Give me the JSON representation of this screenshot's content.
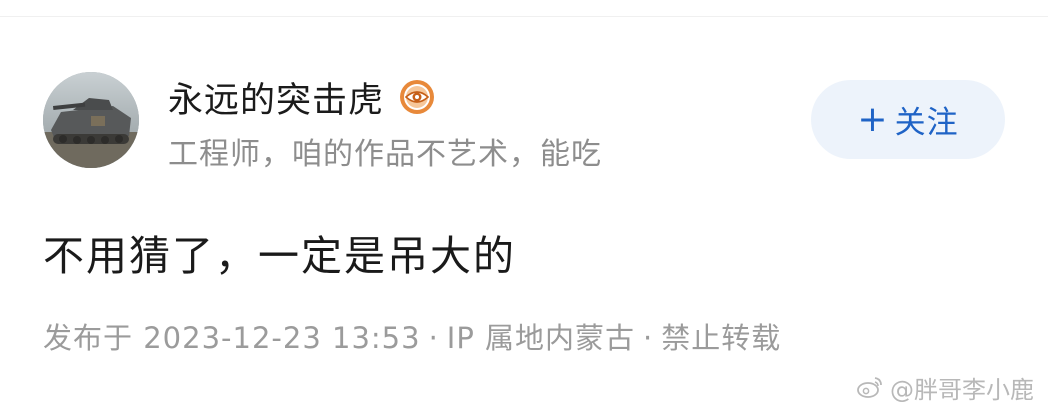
{
  "user": {
    "name": "永远的突击虎",
    "bio": "工程师，咱的作品不艺术，能吃",
    "badge_icon": "orange-eye-badge-icon"
  },
  "actions": {
    "follow_plus": "+",
    "follow_label": "关注"
  },
  "post": {
    "text": "不用猜了，一定是吊大的"
  },
  "meta": {
    "published_prefix": "发布于",
    "datetime": "2023-12-23 13:53",
    "separator": "·",
    "ip_location": "IP 属地内蒙古",
    "repost_policy": "禁止转载"
  },
  "watermark": {
    "text": "@胖哥李小鹿",
    "icon": "weibo-logo-icon"
  },
  "colors": {
    "follow_bg": "#edf3fb",
    "follow_text": "#1f63c6",
    "badge": "#e8893a"
  }
}
